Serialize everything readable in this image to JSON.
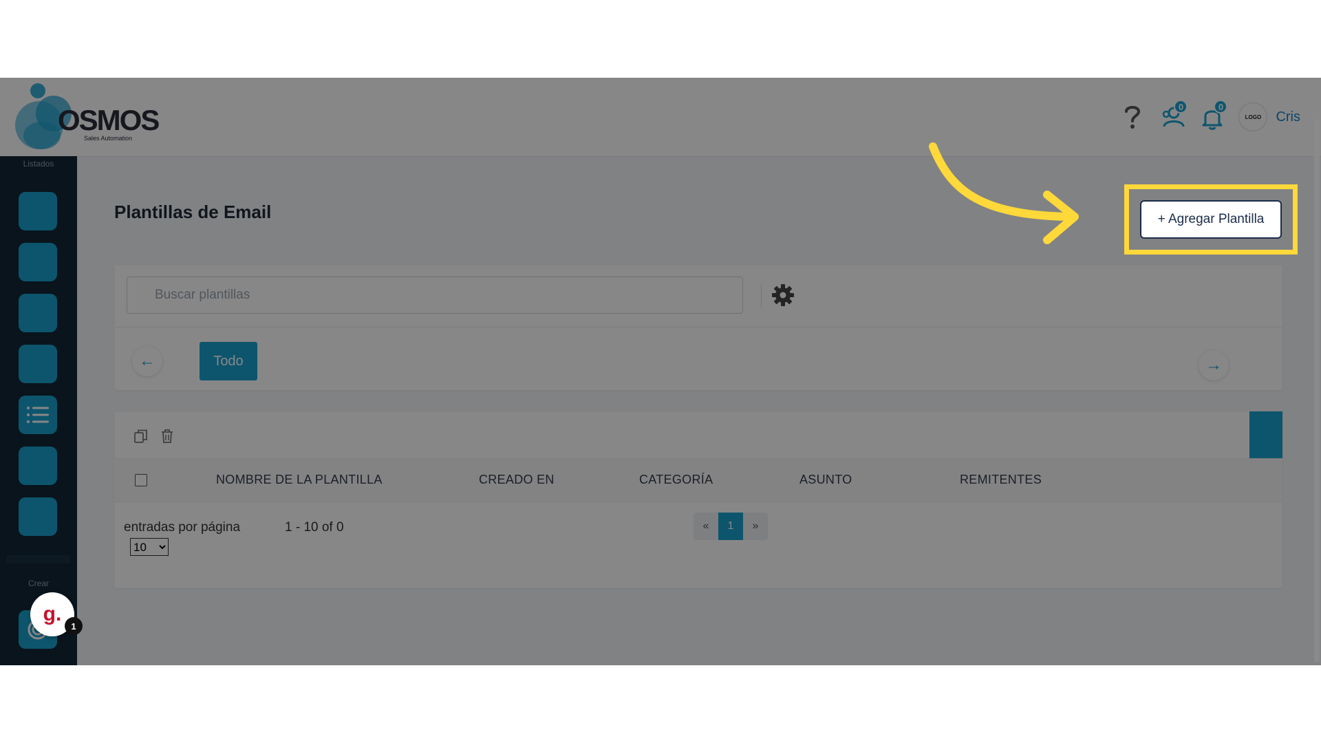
{
  "brand": {
    "name": "OSMOS",
    "tagline": "Sales Automation"
  },
  "header": {
    "help_icon": "question-icon",
    "contacts_badge": "0",
    "notifications_badge": "0",
    "avatar_text": "LOGO",
    "user_name": "Cris"
  },
  "sidebar": {
    "section_lists": "Listados",
    "section_create": "Crear",
    "items": [
      {
        "icon": "square-icon"
      },
      {
        "icon": "square-icon"
      },
      {
        "icon": "square-icon"
      },
      {
        "icon": "square-icon"
      },
      {
        "icon": "list-icon"
      },
      {
        "icon": "square-icon"
      },
      {
        "icon": "square-icon"
      }
    ],
    "create_item": {
      "icon": "target-icon"
    }
  },
  "page": {
    "title": "Plantillas de Email",
    "add_button": "+ Agregar Plantilla"
  },
  "filters": {
    "search_placeholder": "Buscar plantillas",
    "tab_all": "Todo"
  },
  "table": {
    "columns": [
      "NOMBRE DE LA PLANTILLA",
      "CREADO EN",
      "CATEGORÍA",
      "ASUNTO",
      "REMITENTES"
    ],
    "rows": []
  },
  "footer": {
    "entries_label": "entradas por página",
    "range": "1 - 10 of 0",
    "per_page": "10",
    "pagination": {
      "first": "«",
      "current": "1",
      "last": "»"
    }
  },
  "widget": {
    "letter": "g.",
    "count": "1"
  },
  "colors": {
    "accent": "#1aa0cf",
    "sidebar": "#122636",
    "highlight": "#ffd83a"
  }
}
